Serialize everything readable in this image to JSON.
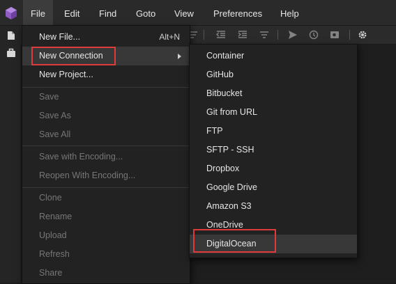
{
  "menubar": {
    "items": [
      "File",
      "Edit",
      "Find",
      "Goto",
      "View",
      "Preferences",
      "Help"
    ],
    "active": "File"
  },
  "file_menu": {
    "items": [
      {
        "label": "New File...",
        "shortcut": "Alt+N",
        "enabled": true
      },
      {
        "label": "New Connection",
        "submenu": true,
        "enabled": true,
        "hover": true
      },
      {
        "label": "New Project...",
        "enabled": true
      },
      {
        "label": "Save",
        "enabled": false
      },
      {
        "label": "Save As",
        "enabled": false
      },
      {
        "label": "Save All",
        "enabled": false
      },
      {
        "label": "Save with Encoding...",
        "enabled": false
      },
      {
        "label": "Reopen With Encoding...",
        "enabled": false
      },
      {
        "label": "Clone",
        "enabled": false
      },
      {
        "label": "Rename",
        "enabled": false
      },
      {
        "label": "Upload",
        "enabled": false
      },
      {
        "label": "Refresh",
        "enabled": false
      },
      {
        "label": "Share",
        "enabled": false
      }
    ]
  },
  "connection_submenu": {
    "items": [
      {
        "label": "Container"
      },
      {
        "label": "GitHub"
      },
      {
        "label": "Bitbucket"
      },
      {
        "label": "Git from URL"
      },
      {
        "label": "FTP"
      },
      {
        "label": "SFTP - SSH"
      },
      {
        "label": "Dropbox"
      },
      {
        "label": "Google Drive"
      },
      {
        "label": "Amazon S3"
      },
      {
        "label": "OneDrive"
      },
      {
        "label": "DigitalOcean",
        "hover": true
      }
    ]
  },
  "colors": {
    "highlight": "#e03b3b",
    "logo": "#8e5cc4",
    "menu_bg": "#222222"
  }
}
